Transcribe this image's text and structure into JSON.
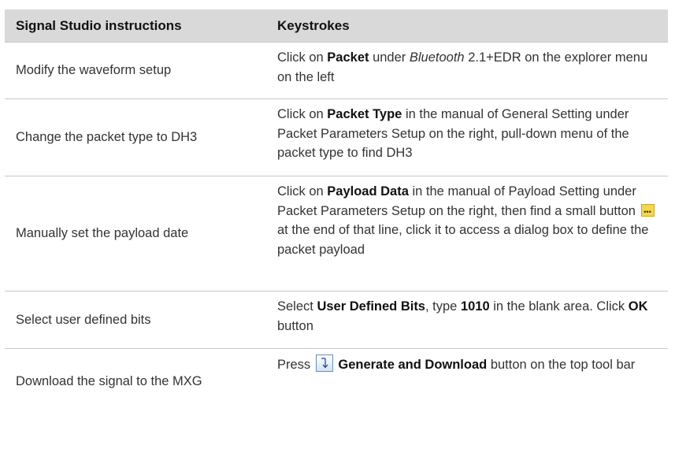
{
  "header": {
    "col1": "Signal Studio instructions",
    "col2": "Keystrokes"
  },
  "rows": [
    {
      "instruction": "Modify the waveform setup",
      "k": [
        "Click on ",
        "Packet",
        " under ",
        "Bluetooth",
        " 2.1+EDR on the explorer menu on the left"
      ]
    },
    {
      "instruction": "Change the packet type to DH3",
      "k": [
        "Click on ",
        "Packet Type",
        " in the manual of General Setting under Packet Parameters Setup on the right, pull-down menu of the packet type to find DH3"
      ]
    },
    {
      "instruction": "Manually set the payload date",
      "k": [
        "Click on ",
        "Payload Data",
        " in the manual of Payload Setting under Packet Parameters Setup on the right, then find a small button ",
        " at the end of that line, click it to access a dialog box to define the packet payload"
      ]
    },
    {
      "instruction": "Select user defined bits",
      "k": [
        "Select ",
        "User Defined Bits",
        ", type ",
        "1010",
        " in the blank area. Click ",
        "OK",
        " button"
      ]
    },
    {
      "instruction": "Download the signal to the MXG",
      "k": [
        "Press ",
        "Generate and Download",
        " button on the top tool bar"
      ]
    }
  ],
  "icons": {
    "ellipsis_button": "ellipsis-button-icon",
    "generate_download": "generate-download-icon"
  },
  "colors": {
    "header_bg": "#d9d9d9",
    "row_divider": "#c8c8c8",
    "ellipsis_button": "#f4d64a"
  }
}
